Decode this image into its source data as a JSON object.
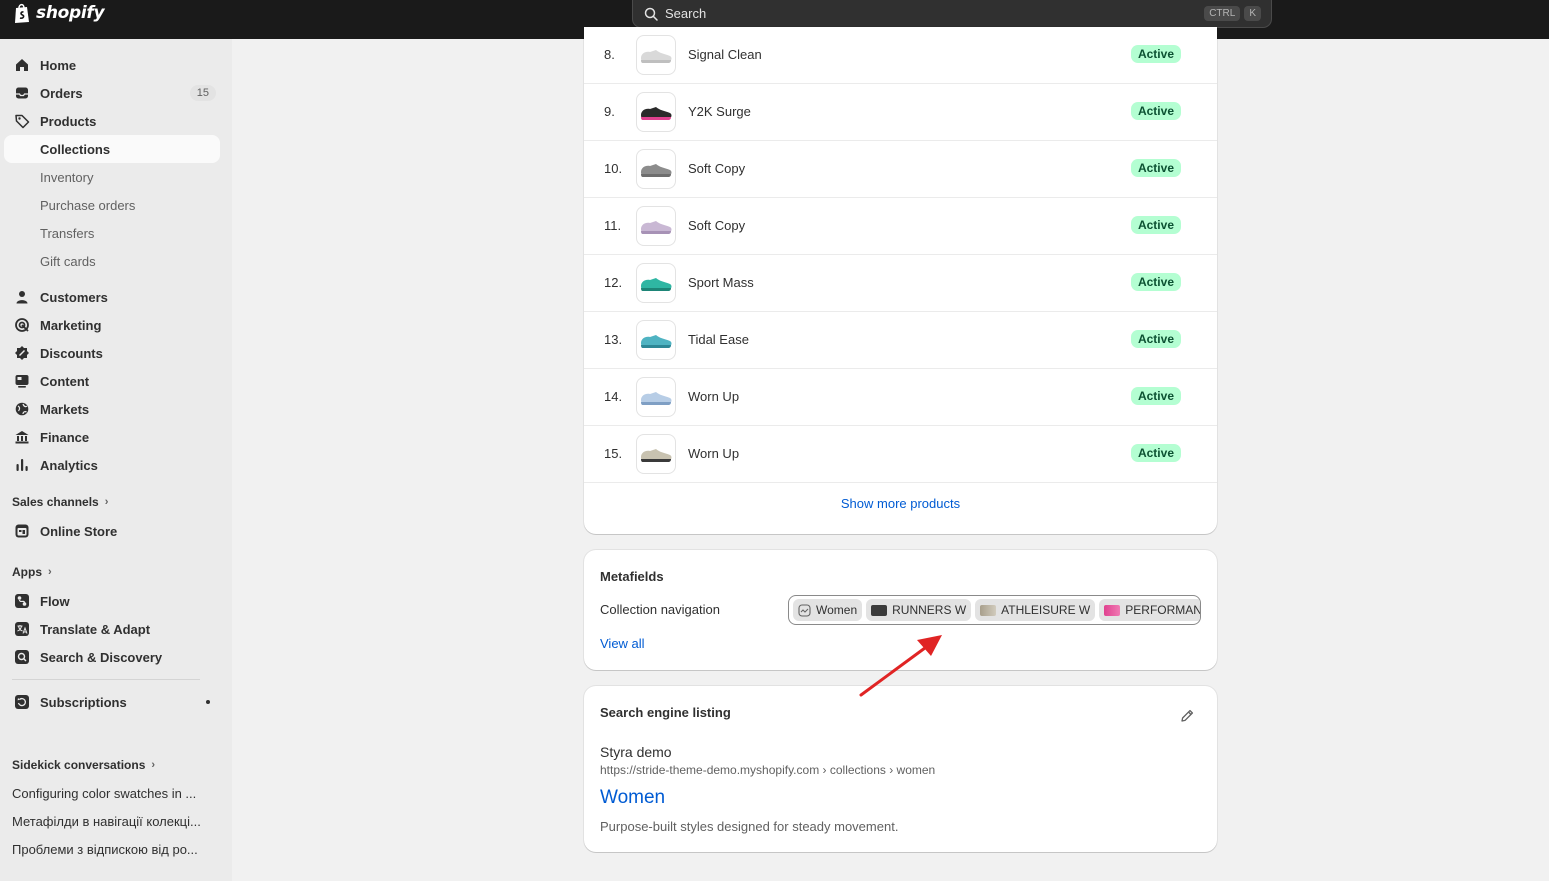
{
  "topbar": {
    "brand": "shopify",
    "search_label": "Search",
    "shortcut_keys": [
      "CTRL",
      "K"
    ]
  },
  "sidebar": {
    "main_items": [
      {
        "label": "Home",
        "icon": "home-icon"
      },
      {
        "label": "Orders",
        "icon": "inbox-icon",
        "badge": "15"
      },
      {
        "label": "Products",
        "icon": "tag-icon"
      }
    ],
    "product_subitems": [
      "Collections",
      "Inventory",
      "Purchase orders",
      "Transfers",
      "Gift cards"
    ],
    "selected": "Collections",
    "more_items": [
      {
        "label": "Customers",
        "icon": "person-icon"
      },
      {
        "label": "Marketing",
        "icon": "target-icon"
      },
      {
        "label": "Discounts",
        "icon": "discount-icon"
      },
      {
        "label": "Content",
        "icon": "content-icon"
      },
      {
        "label": "Markets",
        "icon": "globe-icon"
      },
      {
        "label": "Finance",
        "icon": "bank-icon"
      },
      {
        "label": "Analytics",
        "icon": "bar-chart-icon"
      }
    ],
    "sales_channels_heading": "Sales channels",
    "online_store": "Online Store",
    "apps_heading": "Apps",
    "apps": [
      "Flow",
      "Translate & Adapt",
      "Search & Discovery"
    ],
    "subscriptions": "Subscriptions",
    "sidekick_heading": "Sidekick conversations",
    "conversations": [
      "Configuring color swatches in ...",
      "Метафілди в навігації колекці...",
      "Проблеми з відпискою від ро..."
    ]
  },
  "products": {
    "rows": [
      {
        "num": "8.",
        "title": "Signal Clean",
        "status": "Active",
        "shoe_color": "#d9d9d9",
        "accent": "#bfbfbf"
      },
      {
        "num": "9.",
        "title": "Y2K Surge",
        "status": "Active",
        "shoe_color": "#2a2a2a",
        "accent": "#e0418f"
      },
      {
        "num": "10.",
        "title": "Soft Copy",
        "status": "Active",
        "shoe_color": "#8c8c8c",
        "accent": "#6e6e6e"
      },
      {
        "num": "11.",
        "title": "Soft Copy",
        "status": "Active",
        "shoe_color": "#c9b8d4",
        "accent": "#a792b6"
      },
      {
        "num": "12.",
        "title": "Sport Mass",
        "status": "Active",
        "shoe_color": "#2fb6a3",
        "accent": "#1d8577"
      },
      {
        "num": "13.",
        "title": "Tidal Ease",
        "status": "Active",
        "shoe_color": "#4fb3c2",
        "accent": "#2d8796"
      },
      {
        "num": "14.",
        "title": "Worn Up",
        "status": "Active",
        "shoe_color": "#b7cde6",
        "accent": "#7f9fc4"
      },
      {
        "num": "15.",
        "title": "Worn Up",
        "status": "Active",
        "shoe_color": "#c8c2b0",
        "accent": "#3a3a3a"
      }
    ],
    "show_more": "Show more products"
  },
  "metafields": {
    "title": "Metafields",
    "label": "Collection navigation",
    "chips": [
      {
        "label": "Women",
        "swatch": "icon"
      },
      {
        "label": "RUNNERS W",
        "swatch": "#3b3b3b"
      },
      {
        "label": "ATHLEISURE W",
        "swatch": "#a89f8c"
      },
      {
        "label": "PERFORMAN",
        "swatch": "#e0418f"
      }
    ],
    "view_all": "View all"
  },
  "seo": {
    "title": "Search engine listing",
    "store_name": "Styra demo",
    "url": "https://stride-theme-demo.myshopify.com › collections › women",
    "page_title": "Women",
    "description": "Purpose-built styles designed for steady movement."
  },
  "colors": {
    "accent_link": "#005bd3",
    "success_badge_bg": "#b4fed2",
    "success_badge_text": "#0c5132",
    "annotation_arrow": "#e02424"
  }
}
